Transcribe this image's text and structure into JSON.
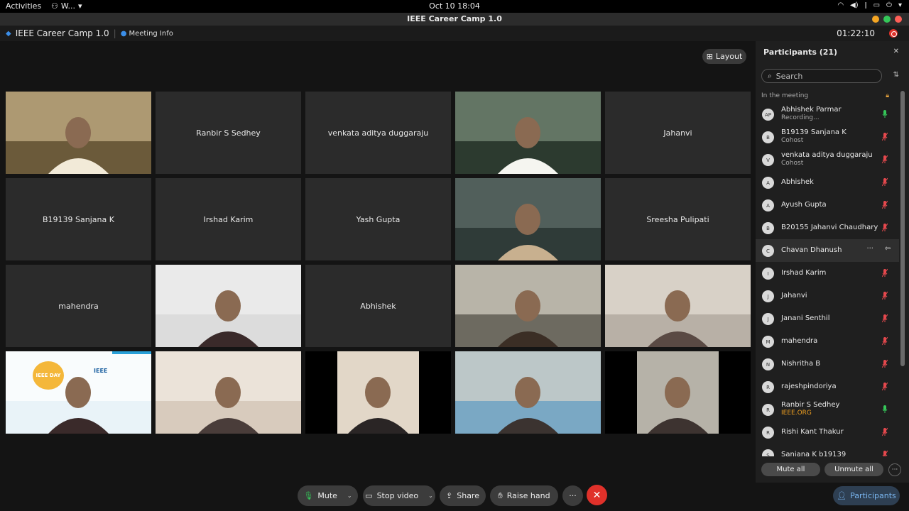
{
  "topbar": {
    "activities": "Activities",
    "app_menu": "W...",
    "clock": "Oct 10  18:04"
  },
  "window": {
    "title": "IEEE Career Camp 1.0"
  },
  "meeting_header": {
    "meeting_name": "IEEE Career Camp 1.0",
    "meeting_info": "Meeting Info",
    "timer": "01:22:10"
  },
  "stage": {
    "layout_label": "Layout",
    "tiles": [
      {
        "kind": "video",
        "name": ""
      },
      {
        "kind": "name",
        "name": "Ranbir S Sedhey"
      },
      {
        "kind": "name",
        "name": "venkata aditya duggaraju"
      },
      {
        "kind": "video",
        "name": ""
      },
      {
        "kind": "name",
        "name": "Jahanvi"
      },
      {
        "kind": "name",
        "name": "B19139 Sanjana K"
      },
      {
        "kind": "name",
        "name": "Irshad Karim"
      },
      {
        "kind": "name",
        "name": "Yash Gupta"
      },
      {
        "kind": "video",
        "name": ""
      },
      {
        "kind": "name",
        "name": "Sreesha Pulipati"
      },
      {
        "kind": "name",
        "name": "mahendra"
      },
      {
        "kind": "video",
        "name": ""
      },
      {
        "kind": "name",
        "name": "Abhishek"
      },
      {
        "kind": "video",
        "name": ""
      },
      {
        "kind": "video",
        "name": ""
      },
      {
        "kind": "video",
        "name": ""
      },
      {
        "kind": "video",
        "name": ""
      },
      {
        "kind": "video",
        "name": ""
      },
      {
        "kind": "video",
        "name": ""
      },
      {
        "kind": "video",
        "name": ""
      }
    ],
    "banner_text": "IEEE",
    "banner_logo_text": "IEEE DAY"
  },
  "participants": {
    "title": "Participants (21)",
    "search_placeholder": "Search",
    "section_label": "In the meeting",
    "list": [
      {
        "initials": "AP",
        "name": "Abhishek Parmar",
        "sub": "Recording...",
        "mic": "on"
      },
      {
        "initials": "B",
        "name": "B19139 Sanjana K",
        "sub": "Cohost",
        "mic": "muted"
      },
      {
        "initials": "V",
        "name": "venkata aditya duggaraju",
        "sub": "Cohost",
        "mic": "muted"
      },
      {
        "initials": "A",
        "name": "Abhishek",
        "sub": "",
        "mic": "muted"
      },
      {
        "initials": "A",
        "name": "Ayush Gupta",
        "sub": "",
        "mic": "muted"
      },
      {
        "initials": "B",
        "name": "B20155 Jahanvi Chaudhary",
        "sub": "",
        "mic": "muted"
      },
      {
        "initials": "C",
        "name": "Chavan Dhanush",
        "sub": "",
        "mic": "hover"
      },
      {
        "initials": "I",
        "name": "Irshad Karim",
        "sub": "",
        "mic": "muted"
      },
      {
        "initials": "J",
        "name": "Jahanvi",
        "sub": "",
        "mic": "muted"
      },
      {
        "initials": "J",
        "name": "Janani Senthil",
        "sub": "",
        "mic": "muted"
      },
      {
        "initials": "M",
        "name": "mahendra",
        "sub": "",
        "mic": "muted"
      },
      {
        "initials": "N",
        "name": "Nishritha B",
        "sub": "",
        "mic": "muted"
      },
      {
        "initials": "R",
        "name": "rajeshpindoriya",
        "sub": "",
        "mic": "muted"
      },
      {
        "initials": "R",
        "name": "Ranbir S Sedhey",
        "sub": "IEEE.ORG",
        "mic": "on"
      },
      {
        "initials": "R",
        "name": "Rishi Kant Thakur",
        "sub": "",
        "mic": "muted"
      },
      {
        "initials": "S",
        "name": "Sanjana K b19139",
        "sub": "",
        "mic": "muted"
      }
    ],
    "mute_all": "Mute all",
    "unmute_all": "Unmute all"
  },
  "controls": {
    "mute": "Mute",
    "stop_video": "Stop video",
    "share": "Share",
    "raise_hand": "Raise hand",
    "participants": "Participants"
  },
  "colors": {
    "end_call": "#e0312a",
    "mic_on": "#35c759",
    "mic_muted": "#e5484d",
    "accent": "#7ab6f0"
  }
}
